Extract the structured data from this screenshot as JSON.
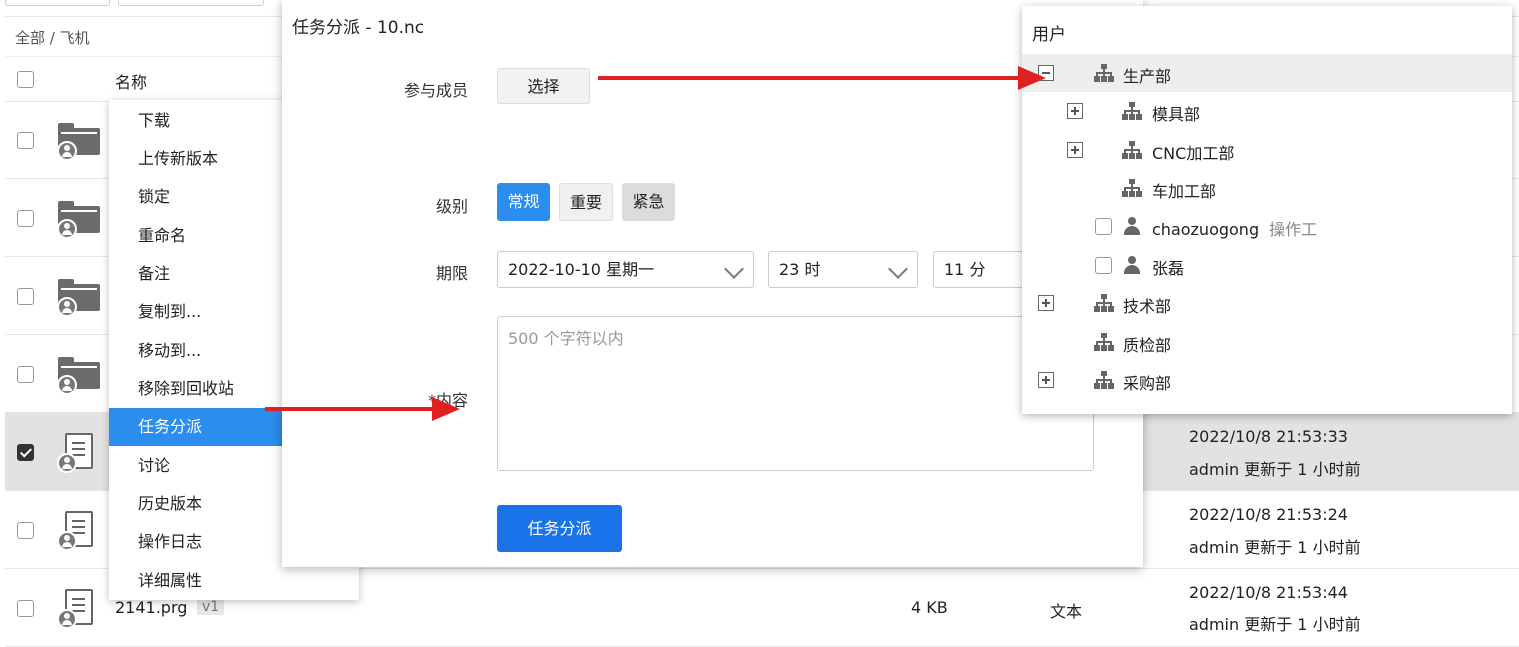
{
  "breadcrumb": "全部 / 飞机",
  "list": {
    "header_name": "名称",
    "rows": [
      {
        "kind": "folder"
      },
      {
        "kind": "folder"
      },
      {
        "kind": "folder"
      },
      {
        "kind": "folder"
      },
      {
        "kind": "doc",
        "selected": true,
        "time": "2022/10/8 21:53:33",
        "updated": "admin 更新于 1 小时前"
      },
      {
        "kind": "doc",
        "time": "2022/10/8 21:53:24",
        "updated": "admin 更新于 1 小时前"
      },
      {
        "kind": "doc",
        "name": "2141.prg",
        "version": "v1",
        "size": "4 KB",
        "type": "文本",
        "time": "2022/10/8 21:53:44",
        "updated": "admin 更新于 1 小时前"
      }
    ]
  },
  "context_menu": {
    "items": [
      "下载",
      "上传新版本",
      "锁定",
      "重命名",
      "备注",
      "复制到...",
      "移动到...",
      "移除到回收站",
      "任务分派",
      "讨论",
      "历史版本",
      "操作日志",
      "详细属性"
    ],
    "active_index": 8
  },
  "dialog": {
    "title": "任务分派 - 10.nc",
    "members_label": "参与成员",
    "select_button": "选择",
    "level_label": "级别",
    "levels": [
      "常规",
      "重要",
      "紧急"
    ],
    "deadline_label": "期限",
    "date_value": "2022-10-10 星期一",
    "hour_value": "23 时",
    "minute_value": "11 分",
    "content_label": "*内容",
    "content_placeholder": "500 个字符以内",
    "submit_button": "任务分派"
  },
  "user_tree": {
    "title": "用户",
    "nodes": [
      {
        "label": "生产部",
        "type": "org",
        "expand": "minus"
      },
      {
        "label": "模具部",
        "type": "org",
        "expand": "plus"
      },
      {
        "label": "CNC加工部",
        "type": "org",
        "expand": "plus"
      },
      {
        "label": "车加工部",
        "type": "org",
        "expand": "none"
      },
      {
        "label": "chaozuogong",
        "sub": "操作工",
        "type": "user"
      },
      {
        "label": "张磊",
        "type": "user"
      },
      {
        "label": "技术部",
        "type": "org",
        "expand": "plus"
      },
      {
        "label": "质检部",
        "type": "org",
        "expand": "none"
      },
      {
        "label": "采购部",
        "type": "org",
        "expand": "plus"
      }
    ]
  },
  "colors": {
    "accent": "#2b8ded",
    "primary": "#1a73e8",
    "annotation": "#e02020"
  }
}
